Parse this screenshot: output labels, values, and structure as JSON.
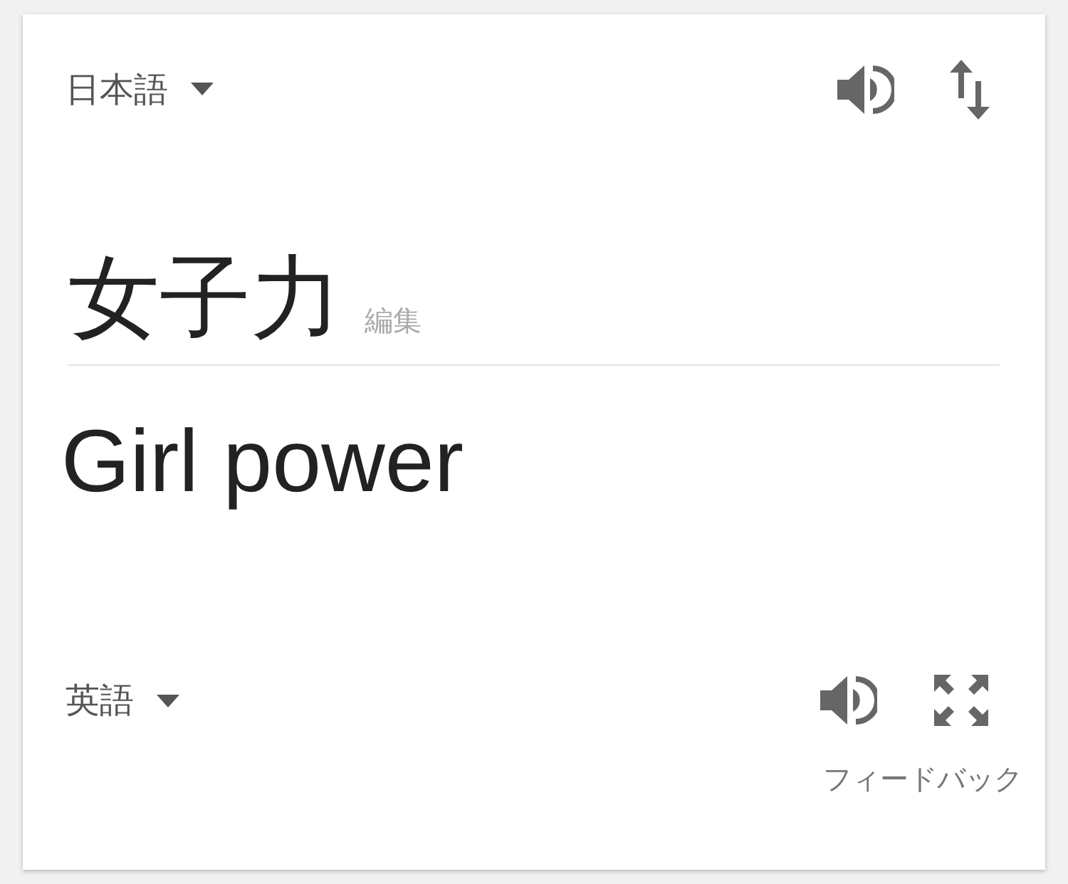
{
  "source": {
    "language": "日本語",
    "text": "女子力",
    "edit_link": "編集"
  },
  "target": {
    "language": "英語",
    "text": "Girl power"
  },
  "feedback": "フィードバック"
}
